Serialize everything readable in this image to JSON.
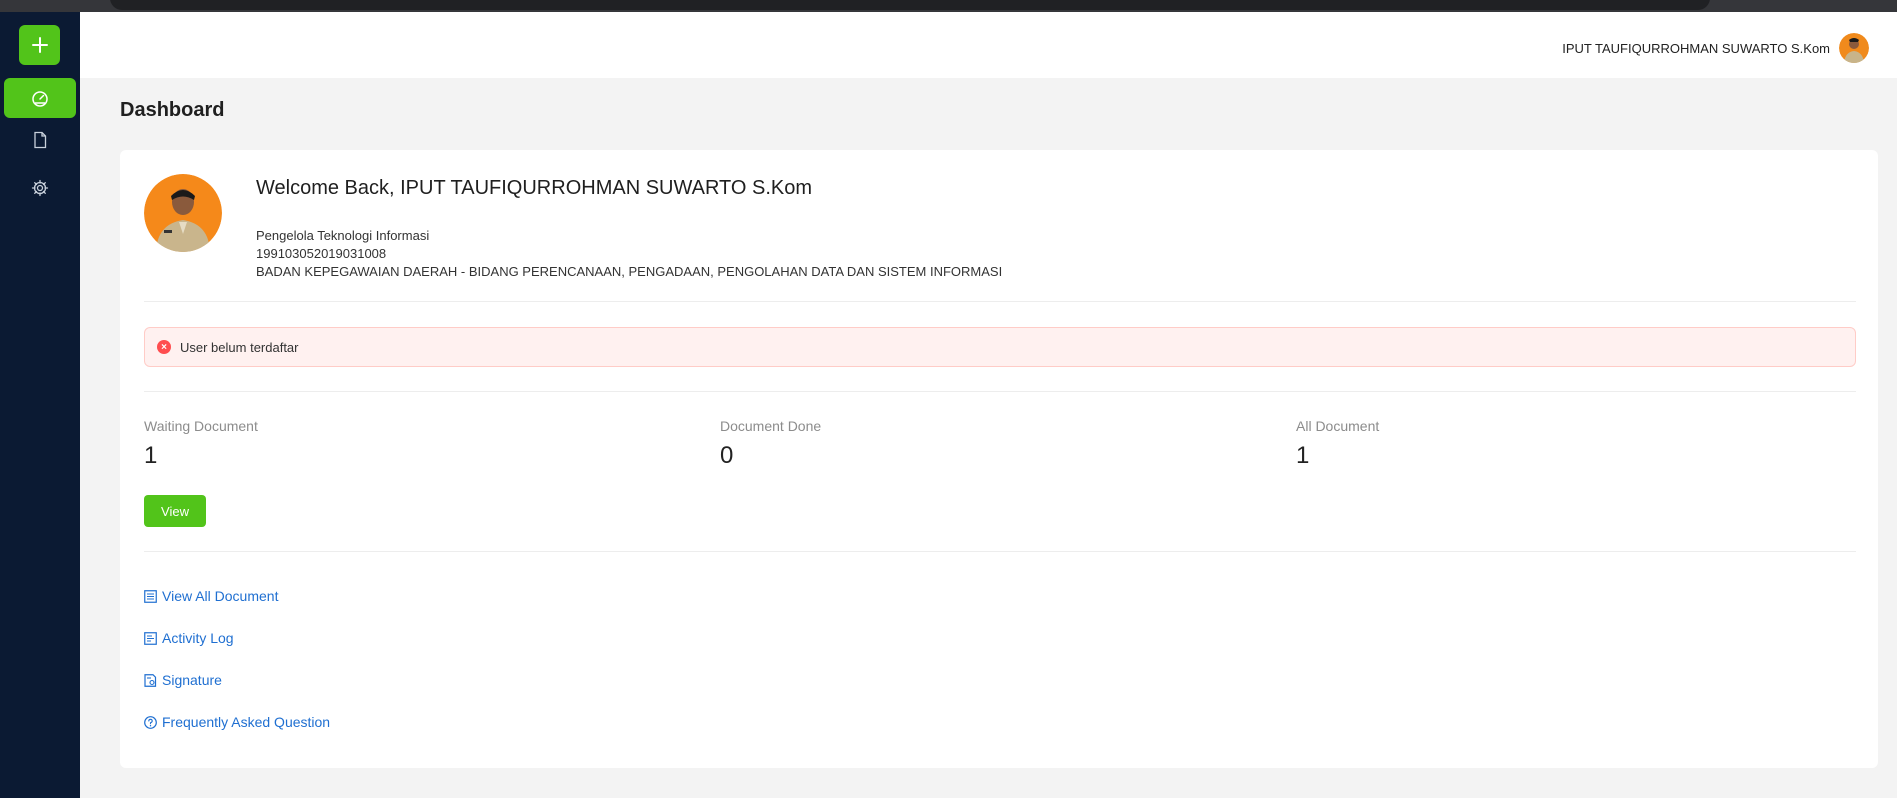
{
  "header": {
    "user_name": "IPUT TAUFIQURROHMAN SUWARTO S.Kom"
  },
  "page": {
    "title": "Dashboard"
  },
  "profile": {
    "welcome": "Welcome Back, IPUT TAUFIQURROHMAN SUWARTO S.Kom",
    "position": "Pengelola Teknologi Informasi",
    "nip": "199103052019031008",
    "unit": "BADAN KEPEGAWAIAN DAERAH - BIDANG PERENCANAAN, PENGADAAN, PENGOLAHAN DATA DAN SISTEM INFORMASI"
  },
  "alert": {
    "message": "User belum terdaftar"
  },
  "stats": [
    {
      "label": "Waiting Document",
      "value": "1"
    },
    {
      "label": "Document Done",
      "value": "0"
    },
    {
      "label": "All Document",
      "value": "1"
    }
  ],
  "view_button": {
    "label": "View"
  },
  "links": [
    {
      "label": "View All Document",
      "icon": "list-icon"
    },
    {
      "label": "Activity Log",
      "icon": "log-icon"
    },
    {
      "label": "Signature",
      "icon": "signature-icon"
    },
    {
      "label": "Frequently Asked Question",
      "icon": "question-icon"
    }
  ],
  "sidebar": {
    "items": [
      {
        "icon": "plus-icon"
      },
      {
        "icon": "dashboard-icon"
      },
      {
        "icon": "file-icon"
      },
      {
        "icon": "gear-icon"
      }
    ]
  },
  "colors": {
    "sidebar_bg": "#0b1a33",
    "accent_green": "#52c41a",
    "alert_bg": "#fff1f0",
    "alert_border": "#ffccc7",
    "error_red": "#ff4d4f",
    "link_blue": "#1f6fd1"
  }
}
